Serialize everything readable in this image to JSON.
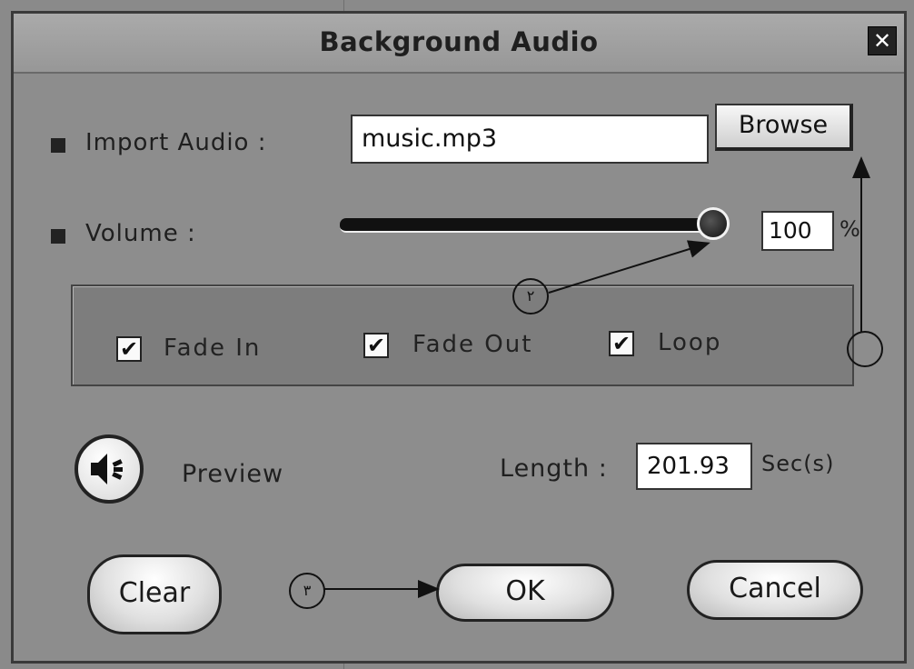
{
  "window": {
    "title": "Background Audio",
    "close_glyph": "✕"
  },
  "import_audio": {
    "label": "Import Audio :",
    "filename": "music.mp3",
    "browse_label": "Browse"
  },
  "volume": {
    "label": "Volume :",
    "value": "100",
    "unit": "%",
    "level_fraction": 1.0
  },
  "options": [
    {
      "label": "Fade In",
      "checked": true
    },
    {
      "label": "Fade Out",
      "checked": true
    },
    {
      "label": "Loop",
      "checked": true
    }
  ],
  "check_glyph": "✔",
  "preview": {
    "label": "Preview",
    "icon": "speaker-icon"
  },
  "length": {
    "label": "Length :",
    "value": "201.93",
    "unit": "Sec(s)"
  },
  "buttons": {
    "clear": "Clear",
    "ok": "OK",
    "cancel": "Cancel"
  },
  "annotations": {
    "marker_2": "٢",
    "marker_3": "٣"
  }
}
